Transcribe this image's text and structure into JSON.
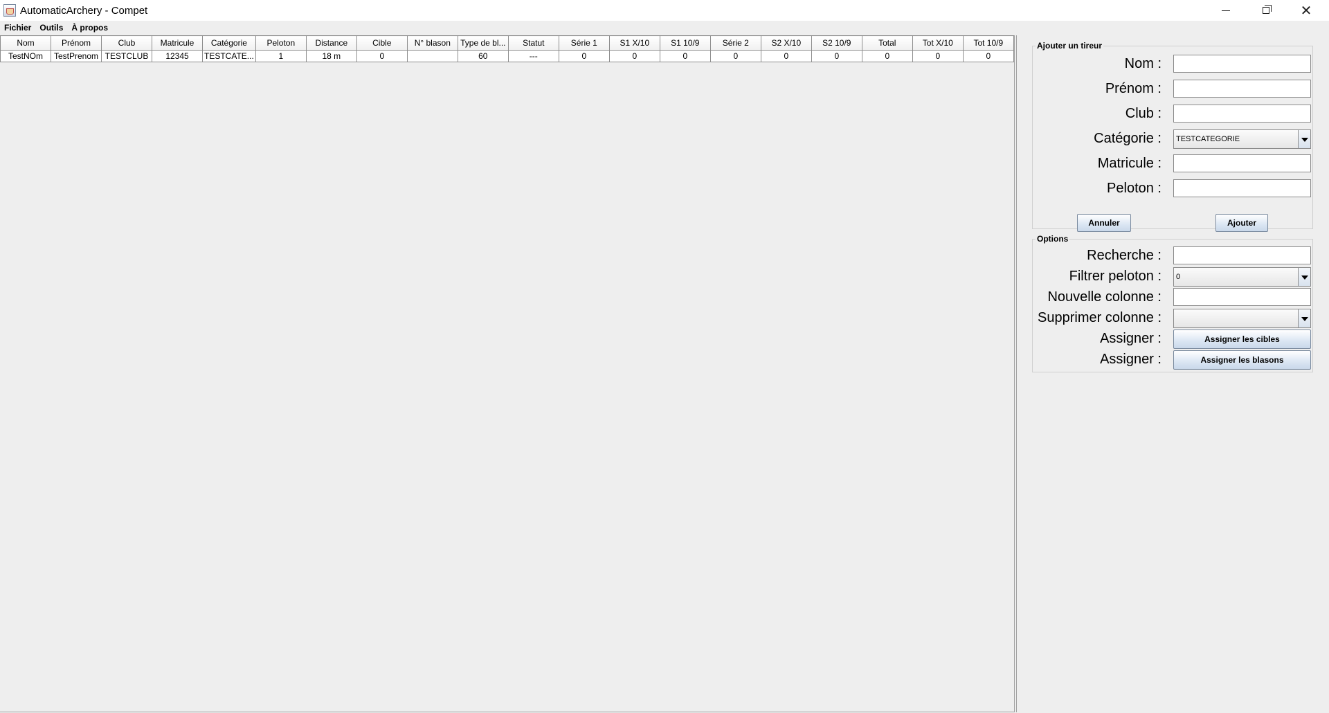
{
  "window": {
    "title": "AutomaticArchery - Compet"
  },
  "menu": {
    "items": [
      "Fichier",
      "Outils",
      "À propos"
    ]
  },
  "table": {
    "columns": [
      "Nom",
      "Prénom",
      "Club",
      "Matricule",
      "Catégorie",
      "Peloton",
      "Distance",
      "Cible",
      "N° blason",
      "Type de bl...",
      "Statut",
      "Série 1",
      "S1 X/10",
      "S1 10/9",
      "Série 2",
      "S2 X/10",
      "S2 10/9",
      "Total",
      "Tot X/10",
      "Tot 10/9"
    ],
    "rows": [
      [
        "TestNOm",
        "TestPrenom",
        "TESTCLUB",
        "12345",
        "TESTCATE...",
        "1",
        "18 m",
        "0",
        "",
        "60",
        "---",
        "0",
        "0",
        "0",
        "0",
        "0",
        "0",
        "0",
        "0",
        "0"
      ]
    ]
  },
  "add_shooter": {
    "legend": "Ajouter un tireur",
    "labels": {
      "nom": "Nom :",
      "prenom": "Prénom :",
      "club": "Club :",
      "categorie": "Catégorie :",
      "matricule": "Matricule :",
      "peloton": "Peloton :"
    },
    "values": {
      "nom": "",
      "prenom": "",
      "club": "",
      "categorie": "TESTCATEGORIE",
      "matricule": "",
      "peloton": ""
    },
    "cancel_label": "Annuler",
    "add_label": "Ajouter"
  },
  "options": {
    "legend": "Options",
    "labels": {
      "recherche": "Recherche :",
      "filtrer": "Filtrer peloton :",
      "nouvelle": "Nouvelle colonne :",
      "supprimer": "Supprimer colonne :",
      "assigner1": "Assigner :",
      "assigner2": "Assigner :"
    },
    "values": {
      "recherche": "",
      "filtrer": "0",
      "nouvelle": "",
      "supprimer": ""
    },
    "assign_targets_label": "Assigner les cibles",
    "assign_faces_label": "Assigner les blasons"
  }
}
